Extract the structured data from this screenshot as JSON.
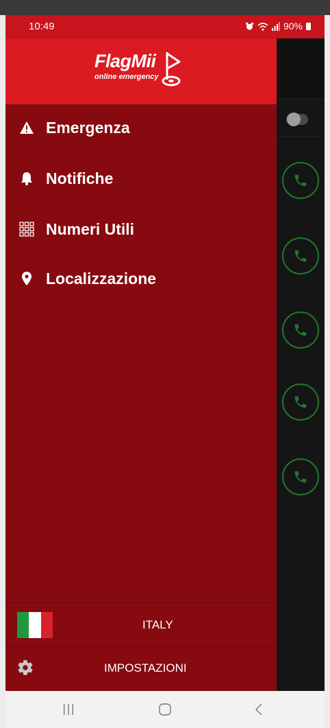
{
  "status_bar": {
    "time": "10:49",
    "battery": "90%"
  },
  "app": {
    "logo_name": "FlagMii",
    "logo_tagline": "online emergency"
  },
  "menu": {
    "items": [
      {
        "label": "Emergenza",
        "icon": "warning-icon"
      },
      {
        "label": "Notifiche",
        "icon": "bell-icon"
      },
      {
        "label": "Numeri Utili",
        "icon": "grid-icon"
      },
      {
        "label": "Localizzazione",
        "icon": "location-pin-icon"
      }
    ]
  },
  "footer": {
    "country": "ITALY",
    "settings": "IMPOSTAZIONI"
  },
  "colors": {
    "drawer_bg": "#860a10",
    "header_red": "#dc1a22",
    "call_green": "#1f7a2c"
  }
}
